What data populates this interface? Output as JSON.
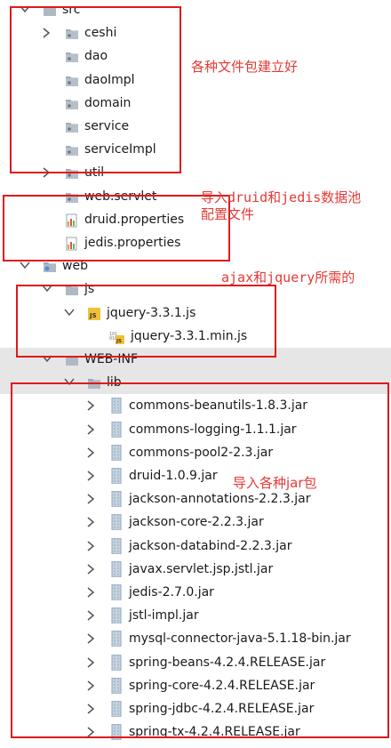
{
  "tree": [
    {
      "label": "src",
      "indent": 0,
      "icon": "folder-icon",
      "arrow": "down"
    },
    {
      "label": "ceshi",
      "indent": 1,
      "icon": "package-icon",
      "arrow": "right"
    },
    {
      "label": "dao",
      "indent": 1,
      "icon": "package-icon",
      "arrow": "none"
    },
    {
      "label": "daoImpl",
      "indent": 1,
      "icon": "package-icon",
      "arrow": "none"
    },
    {
      "label": "domain",
      "indent": 1,
      "icon": "package-icon",
      "arrow": "none"
    },
    {
      "label": "service",
      "indent": 1,
      "icon": "package-icon",
      "arrow": "none"
    },
    {
      "label": "serviceImpl",
      "indent": 1,
      "icon": "package-icon",
      "arrow": "none"
    },
    {
      "label": "util",
      "indent": 1,
      "icon": "package-icon",
      "arrow": "right"
    },
    {
      "label": "web.servlet",
      "indent": 1,
      "icon": "package-icon",
      "arrow": "none"
    },
    {
      "label": "druid.properties",
      "indent": 1,
      "icon": "properties-file-icon",
      "arrow": "none"
    },
    {
      "label": "jedis.properties",
      "indent": 1,
      "icon": "properties-file-icon",
      "arrow": "none"
    },
    {
      "label": "web",
      "indent": 0,
      "icon": "web-folder-icon",
      "arrow": "down"
    },
    {
      "label": "js",
      "indent": 1,
      "icon": "folder-icon",
      "arrow": "down"
    },
    {
      "label": "jquery-3.3.1.js",
      "indent": 2,
      "icon": "js-file-icon",
      "arrow": "down"
    },
    {
      "label": "jquery-3.3.1.min.js",
      "indent": 3,
      "icon": "binary-js-file-icon",
      "arrow": "none"
    },
    {
      "label": "WEB-INF",
      "indent": 1,
      "icon": "folder-icon",
      "arrow": "down",
      "highlight": true
    },
    {
      "label": "lib",
      "indent": 2,
      "icon": "folder-icon",
      "arrow": "down",
      "highlight": true
    },
    {
      "label": "commons-beanutils-1.8.3.jar",
      "indent": 3,
      "icon": "jar-icon",
      "arrow": "right"
    },
    {
      "label": "commons-logging-1.1.1.jar",
      "indent": 3,
      "icon": "jar-icon",
      "arrow": "right"
    },
    {
      "label": "commons-pool2-2.3.jar",
      "indent": 3,
      "icon": "jar-icon",
      "arrow": "right"
    },
    {
      "label": "druid-1.0.9.jar",
      "indent": 3,
      "icon": "jar-icon",
      "arrow": "right"
    },
    {
      "label": "jackson-annotations-2.2.3.jar",
      "indent": 3,
      "icon": "jar-icon",
      "arrow": "right"
    },
    {
      "label": "jackson-core-2.2.3.jar",
      "indent": 3,
      "icon": "jar-icon",
      "arrow": "right"
    },
    {
      "label": "jackson-databind-2.2.3.jar",
      "indent": 3,
      "icon": "jar-icon",
      "arrow": "right"
    },
    {
      "label": "javax.servlet.jsp.jstl.jar",
      "indent": 3,
      "icon": "jar-icon",
      "arrow": "right"
    },
    {
      "label": "jedis-2.7.0.jar",
      "indent": 3,
      "icon": "jar-icon",
      "arrow": "right"
    },
    {
      "label": "jstl-impl.jar",
      "indent": 3,
      "icon": "jar-icon",
      "arrow": "right"
    },
    {
      "label": "mysql-connector-java-5.1.18-bin.jar",
      "indent": 3,
      "icon": "jar-icon",
      "arrow": "right"
    },
    {
      "label": "spring-beans-4.2.4.RELEASE.jar",
      "indent": 3,
      "icon": "jar-icon",
      "arrow": "right"
    },
    {
      "label": "spring-core-4.2.4.RELEASE.jar",
      "indent": 3,
      "icon": "jar-icon",
      "arrow": "right"
    },
    {
      "label": "spring-jdbc-4.2.4.RELEASE.jar",
      "indent": 3,
      "icon": "jar-icon",
      "arrow": "right"
    },
    {
      "label": "spring-tx-4.2.4.RELEASE.jar",
      "indent": 3,
      "icon": "jar-icon",
      "arrow": "right"
    }
  ],
  "annotations": {
    "packages": "各种文件包建立好",
    "config_line1": "导入druid和jedis数据池",
    "config_line2": "配置文件",
    "js": "ajax和jquery所需的",
    "jars": "导入各种jar包"
  },
  "colors": {
    "annotation": "#e53935",
    "box": "#e0191b",
    "folder": "#9aa7b4",
    "jar": "#8fa6bc",
    "highlight_row": "#e6e6e6"
  }
}
